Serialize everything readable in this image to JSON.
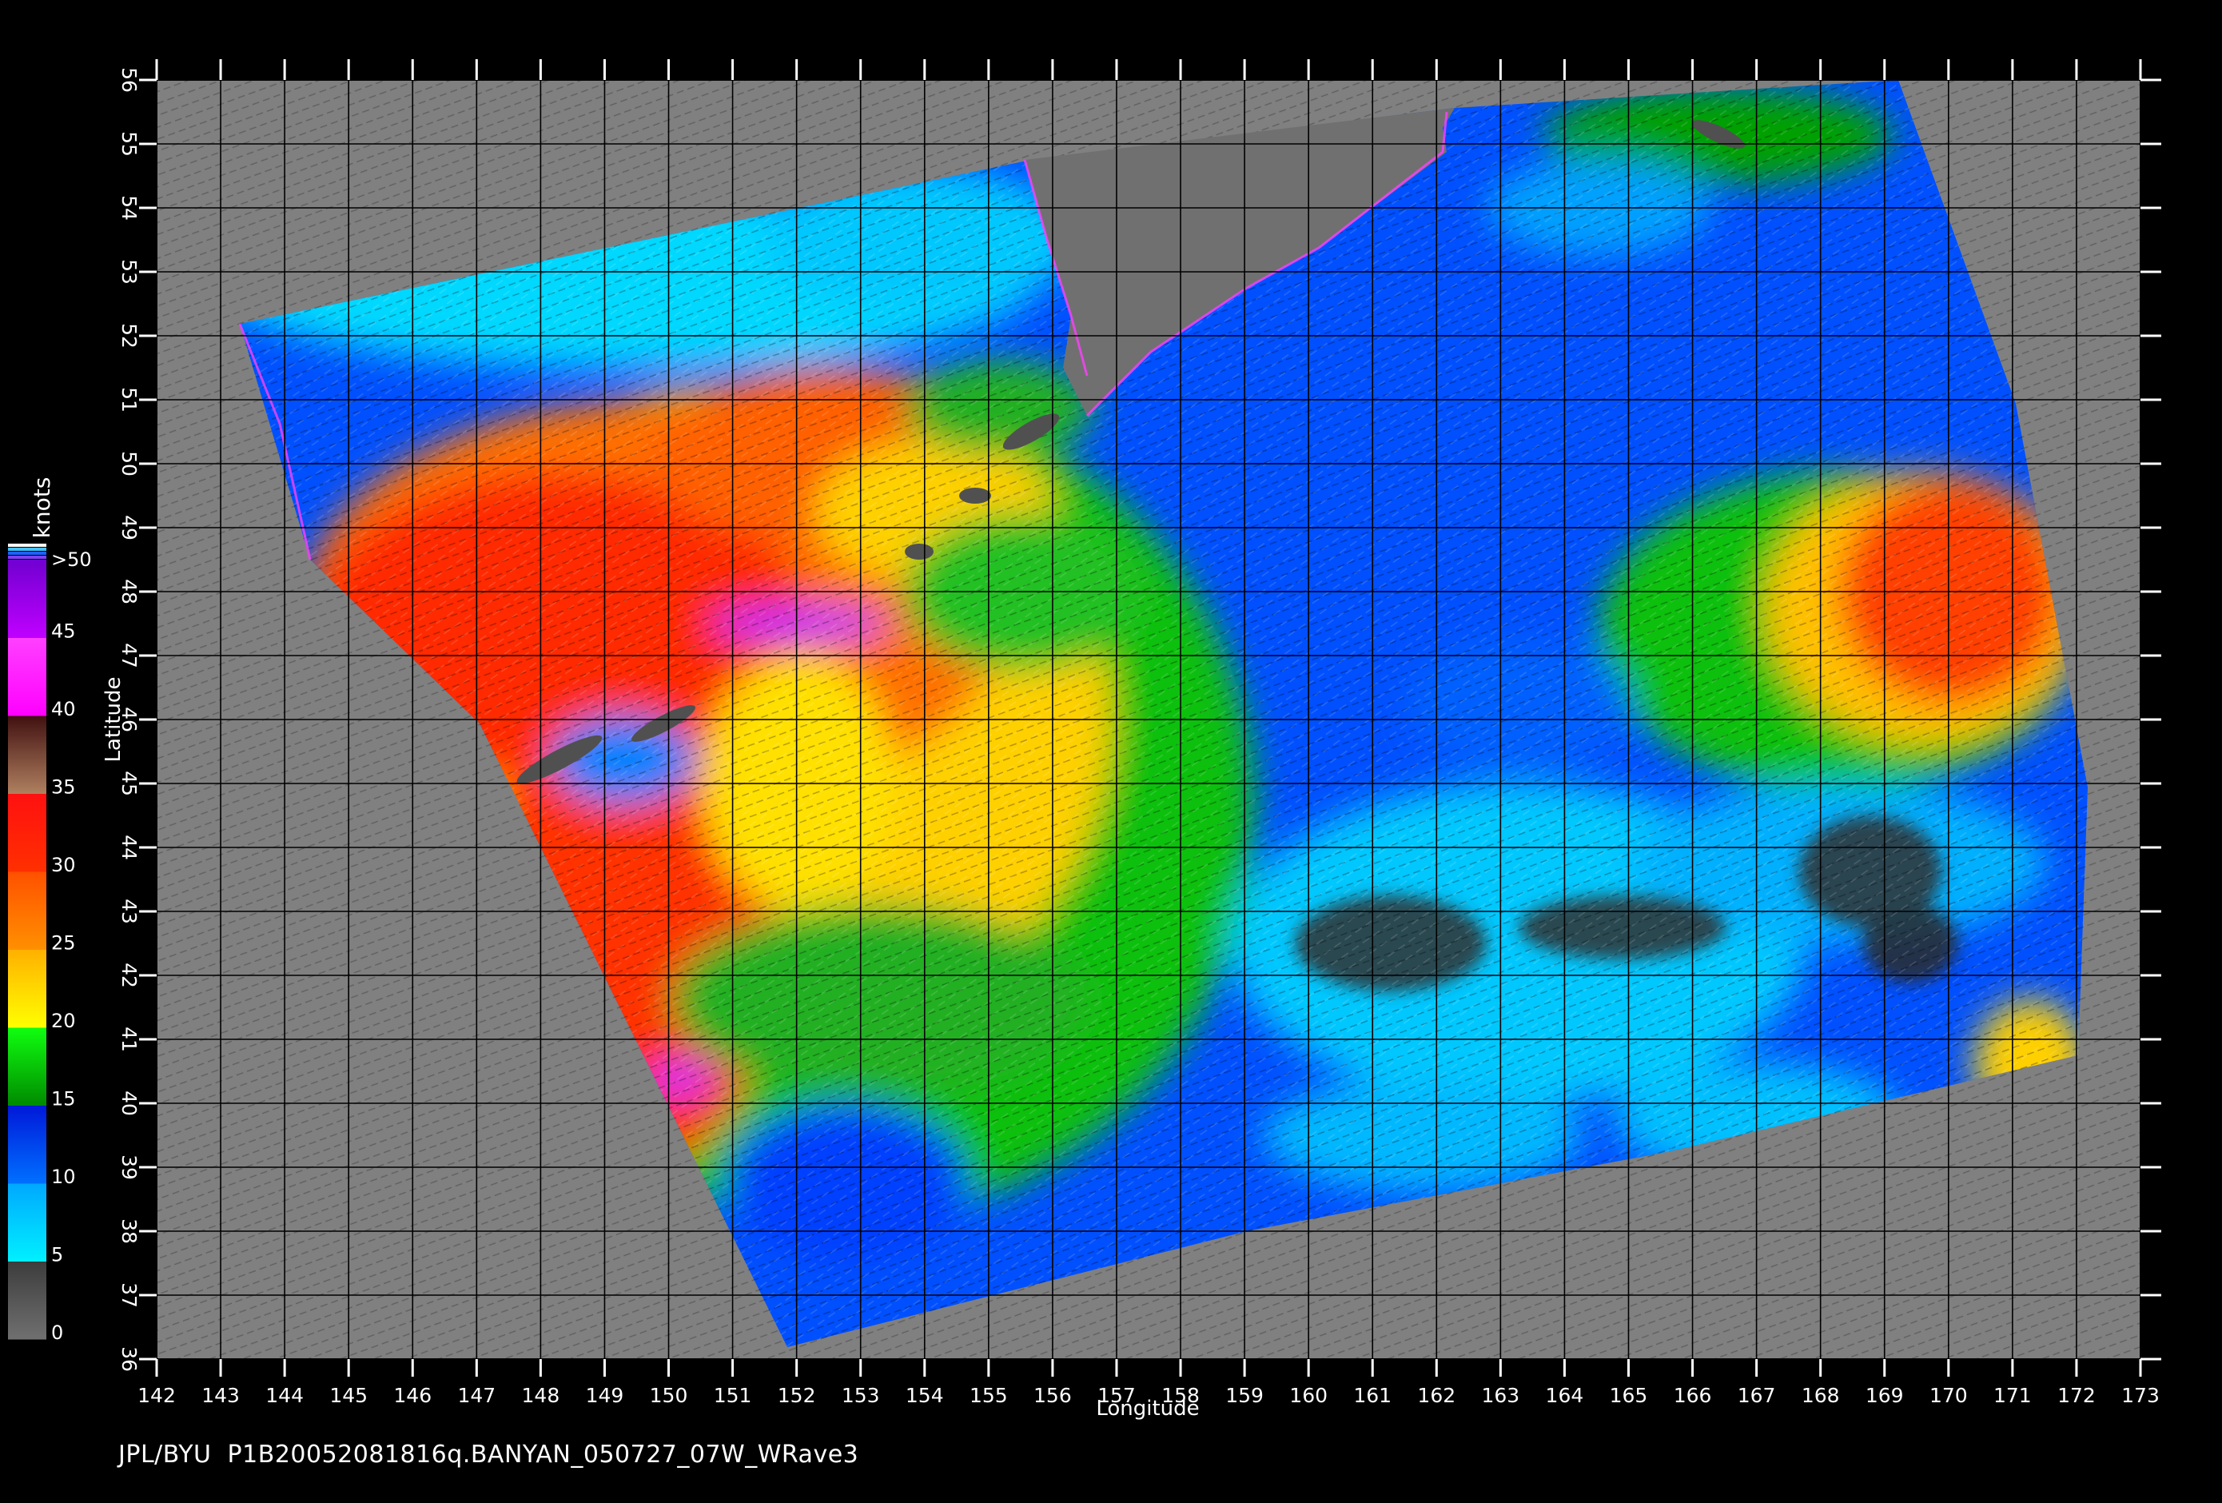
{
  "map": {
    "lon_range": [
      142,
      173
    ],
    "lat_range": [
      36,
      56
    ],
    "lon_ticks": [
      142,
      143,
      144,
      145,
      146,
      147,
      148,
      149,
      150,
      151,
      152,
      153,
      154,
      155,
      156,
      157,
      158,
      159,
      160,
      161,
      162,
      163,
      164,
      165,
      166,
      167,
      168,
      169,
      170,
      171,
      172,
      173
    ],
    "lat_ticks": [
      36,
      37,
      38,
      39,
      40,
      41,
      42,
      43,
      44,
      45,
      46,
      47,
      48,
      49,
      50,
      51,
      52,
      53,
      54,
      55,
      56
    ],
    "xlabel": "Longitude",
    "ylabel": "Latitude",
    "land_color": "#808080",
    "grid_color": "#000000"
  },
  "colorbar": {
    "unit": "knots",
    "ticks": [
      "0",
      "5",
      "10",
      "15",
      "20",
      "25",
      "30",
      "35",
      "40",
      "45",
      ">50"
    ],
    "bands": [
      {
        "from": 0,
        "to": 5,
        "colors": [
          "#707070",
          "#3c3c3c"
        ]
      },
      {
        "from": 5,
        "to": 10,
        "colors": [
          "#00f0ff",
          "#00a8ff"
        ]
      },
      {
        "from": 10,
        "to": 15,
        "colors": [
          "#0070ff",
          "#0018d8"
        ]
      },
      {
        "from": 15,
        "to": 20,
        "colors": [
          "#008a00",
          "#10ff10"
        ]
      },
      {
        "from": 20,
        "to": 25,
        "colors": [
          "#ffff00",
          "#ffb000"
        ]
      },
      {
        "from": 25,
        "to": 30,
        "colors": [
          "#ff9000",
          "#ff5000"
        ]
      },
      {
        "from": 30,
        "to": 35,
        "colors": [
          "#ff3000",
          "#ff1010"
        ]
      },
      {
        "from": 35,
        "to": 40,
        "colors": [
          "#b08060",
          "#401010"
        ]
      },
      {
        "from": 40,
        "to": 45,
        "colors": [
          "#ff00ff",
          "#ff40ff"
        ]
      },
      {
        "from": 45,
        "to": 50,
        "colors": [
          "#c000ff",
          "#7000d0"
        ]
      }
    ]
  },
  "footer": {
    "text": "JPL/BYU  P1B20052081816q.BANYAN_050727_07W_WRave3"
  }
}
